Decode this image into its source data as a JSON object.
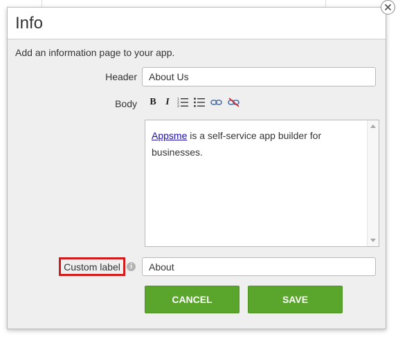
{
  "dialog": {
    "title": "Info",
    "description": "Add an information page to your app."
  },
  "form": {
    "header_label": "Header",
    "header_value": "About Us",
    "body_label": "Body",
    "body_link_text": "Appsme",
    "body_text_rest": " is a self-service app builder for businesses.",
    "custom_label_label": "Custom label",
    "custom_label_value": "About"
  },
  "toolbar": {
    "bold": "B",
    "italic": "I",
    "icons": [
      "bold-icon",
      "italic-icon",
      "numbered-list-icon",
      "bulleted-list-icon",
      "link-icon",
      "unlink-icon"
    ]
  },
  "info_icon_glyph": "i",
  "buttons": {
    "cancel": "CANCEL",
    "save": "SAVE"
  },
  "colors": {
    "button_green": "#5aa62d",
    "highlight_red": "#d21a1a",
    "link_blue": "#1a0dab"
  }
}
